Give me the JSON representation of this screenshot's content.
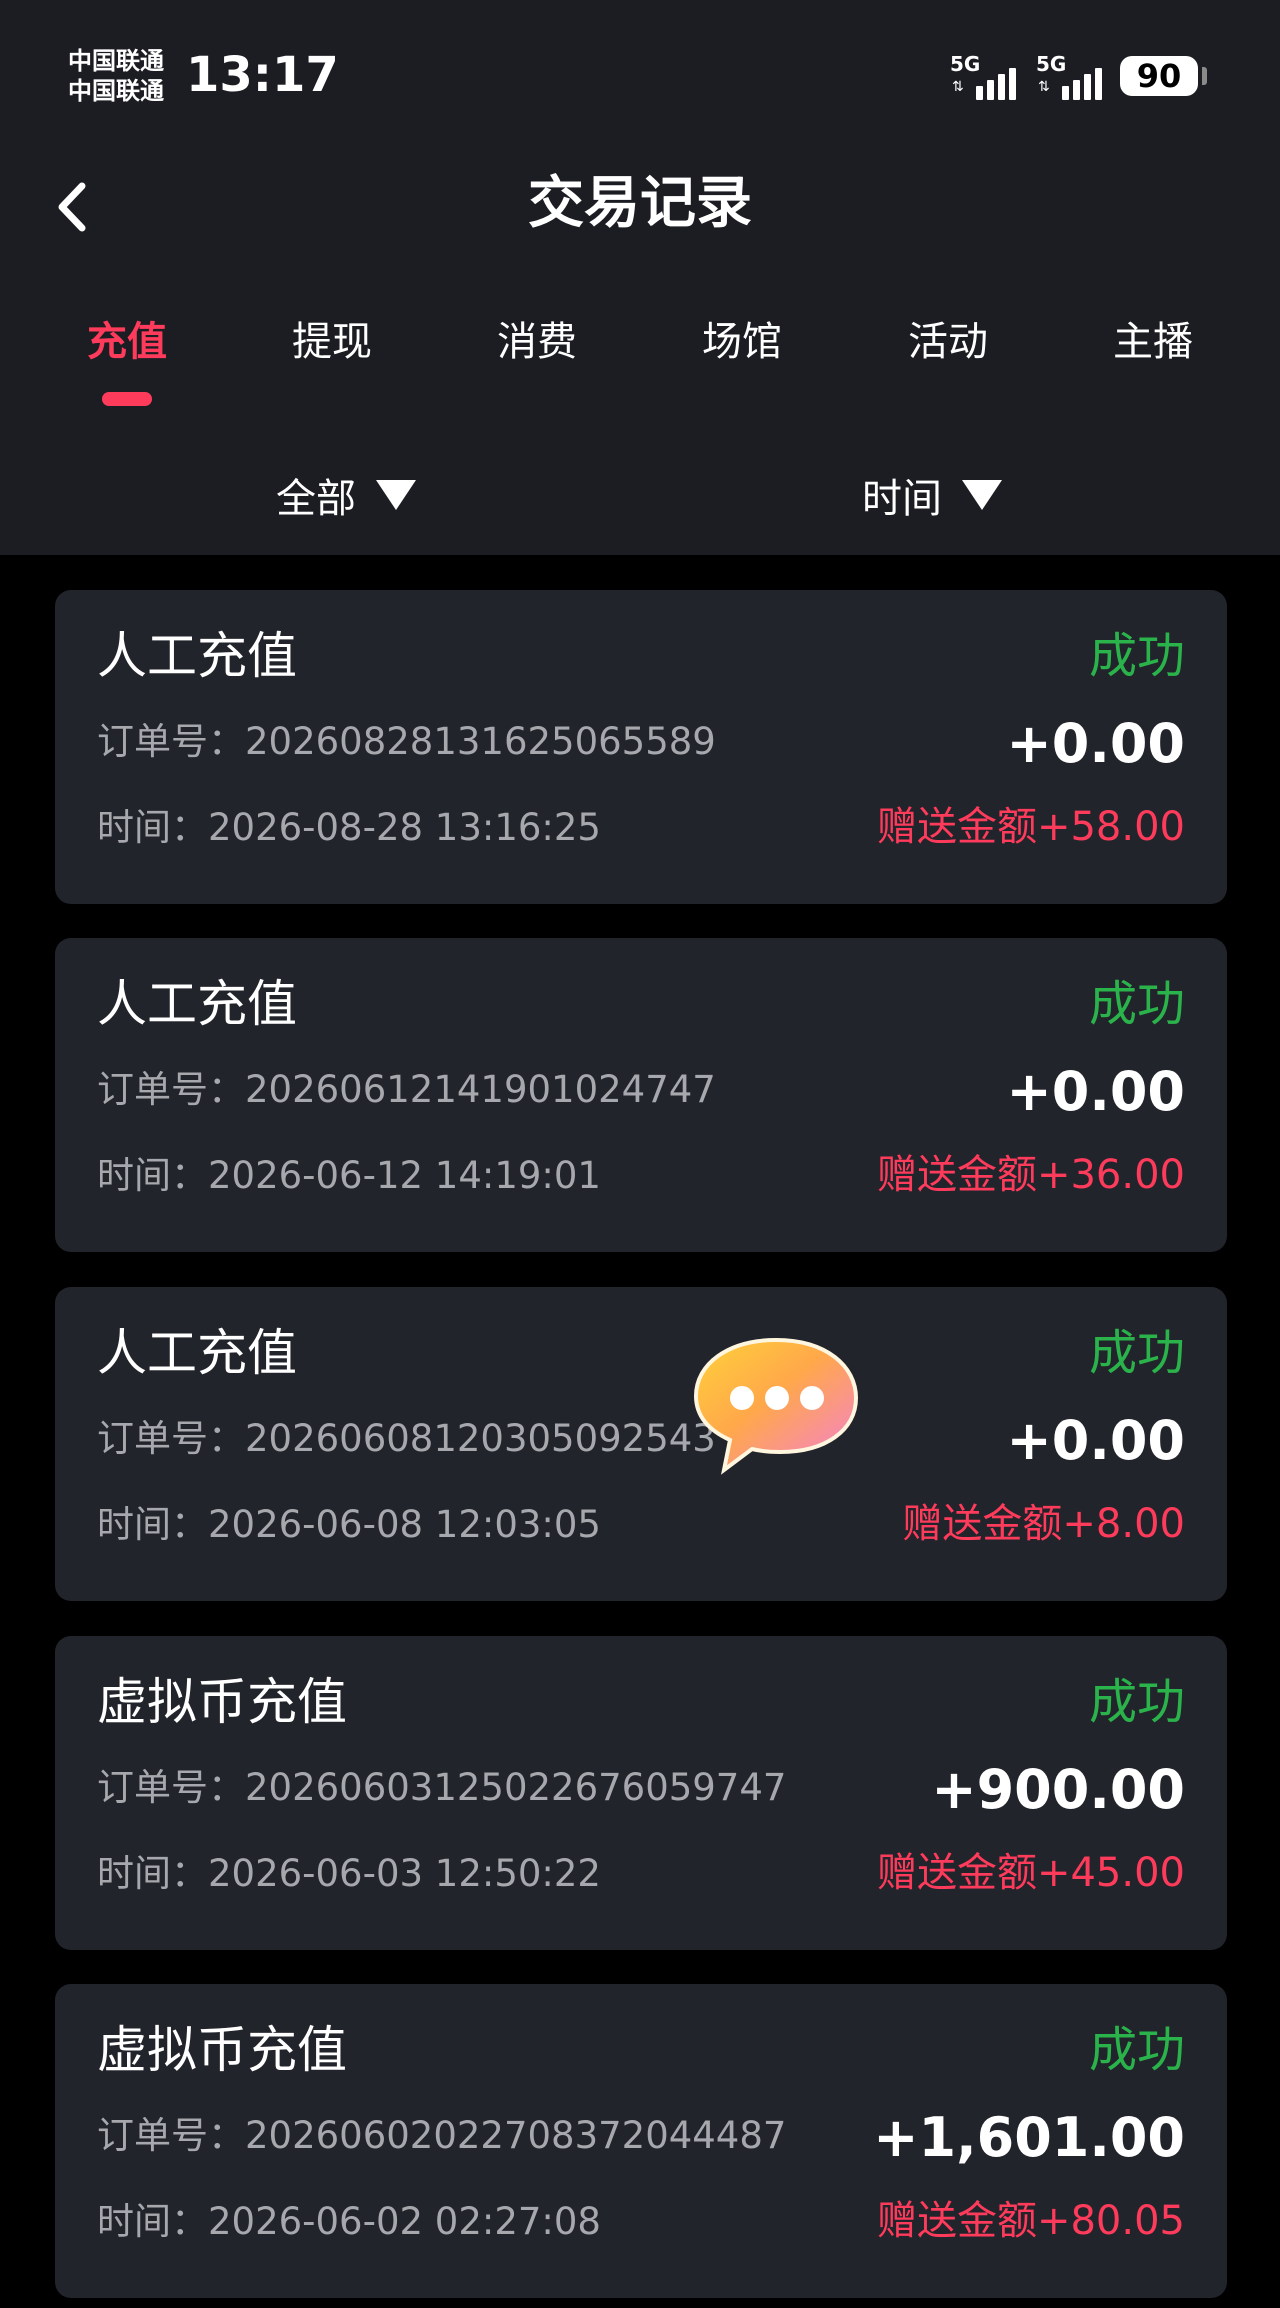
{
  "status_bar": {
    "carrier_1": "中国联通",
    "carrier_2": "中国联通",
    "time": "13:17",
    "network_1": "5G",
    "network_2": "5G",
    "battery": "90"
  },
  "nav": {
    "title": "交易记录",
    "back_icon": "chevron-left-icon"
  },
  "tabs": [
    {
      "label": "充值",
      "active": true
    },
    {
      "label": "提现",
      "active": false
    },
    {
      "label": "消费",
      "active": false
    },
    {
      "label": "场馆",
      "active": false
    },
    {
      "label": "活动",
      "active": false
    },
    {
      "label": "主播",
      "active": false
    }
  ],
  "filters": {
    "type": "全部",
    "time": "时间"
  },
  "colors": {
    "accent": "#ff3b5c",
    "success": "#2bb34b",
    "card_bg": "#22242b",
    "header_bg": "#1b1d23"
  },
  "records": [
    {
      "title": "人工充值",
      "status": "成功",
      "order": "订单号：20260828131625065589",
      "amount": "+0.00",
      "time": "时间：2026-08-28 13:16:25",
      "bonus": "赠送金额+58.00"
    },
    {
      "title": "人工充值",
      "status": "成功",
      "order": "订单号：20260612141901024747",
      "amount": "+0.00",
      "time": "时间：2026-06-12 14:19:01",
      "bonus": "赠送金额+36.00"
    },
    {
      "title": "人工充值",
      "status": "成功",
      "order": "订单号：20260608120305092543",
      "amount": "+0.00",
      "time": "时间：2026-06-08 12:03:05",
      "bonus": "赠送金额+8.00"
    },
    {
      "title": "虚拟币充值",
      "status": "成功",
      "order": "订单号：20260603125022676059747",
      "amount": "+900.00",
      "time": "时间：2026-06-03 12:50:22",
      "bonus": "赠送金额+45.00"
    },
    {
      "title": "虚拟币充值",
      "status": "成功",
      "order": "订单号：20260602022708372044487",
      "amount": "+1,601.00",
      "time": "时间：2026-06-02 02:27:08",
      "bonus": "赠送金额+80.05"
    }
  ],
  "floating": {
    "icon": "chat-bubble-icon"
  }
}
